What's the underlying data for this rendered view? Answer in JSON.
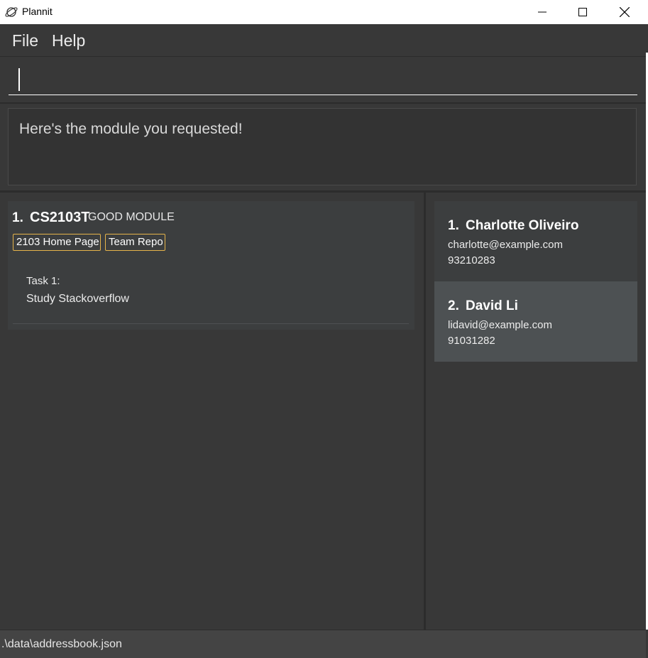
{
  "window": {
    "title": "Plannit",
    "app_icon": "planet-icon",
    "controls": {
      "minimize": "minimize-icon",
      "maximize": "maximize-icon",
      "close": "close-icon"
    }
  },
  "menu": {
    "items": [
      {
        "label": "File"
      },
      {
        "label": "Help"
      }
    ]
  },
  "command": {
    "value": "",
    "placeholder": ""
  },
  "result": {
    "message": "Here's the module you requested!"
  },
  "modules": [
    {
      "index": "1.",
      "code": "CS2103T",
      "name": "GOOD MODULE",
      "links": [
        "2103 Home Page",
        "Team Repo"
      ],
      "tasks": [
        {
          "label": "Task 1:",
          "description": "Study Stackoverflow"
        }
      ]
    }
  ],
  "persons": [
    {
      "index": "1.",
      "name": "Charlotte Oliveiro",
      "email": "charlotte@example.com",
      "phone": "93210283",
      "selected": false
    },
    {
      "index": "2.",
      "name": "David Li",
      "email": "lidavid@example.com",
      "phone": "91031282",
      "selected": true
    }
  ],
  "status": {
    "path": ".\\data\\addressbook.json"
  },
  "colors": {
    "background": "#383838",
    "card": "#3c3e3f",
    "selected_card": "#4d5153",
    "tag_border": "#e5b34a"
  }
}
